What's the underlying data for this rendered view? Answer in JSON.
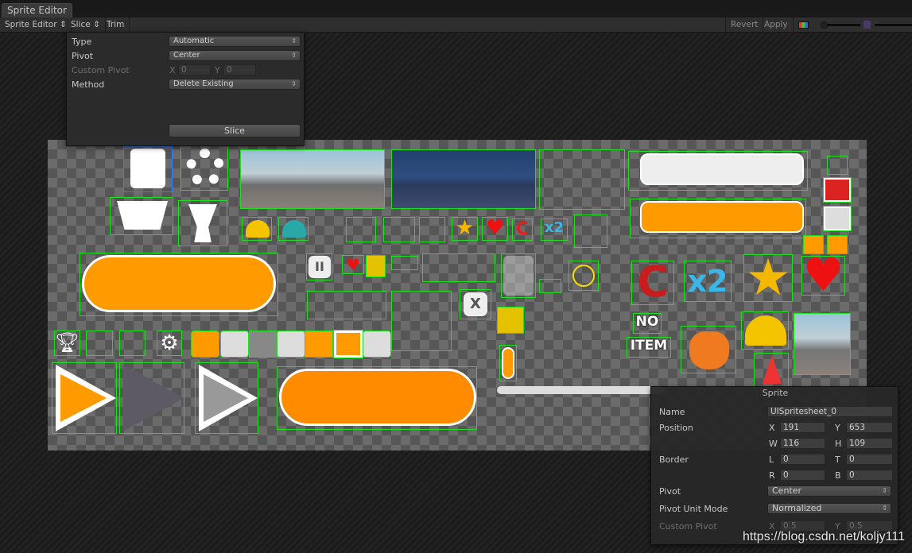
{
  "window": {
    "tab": "Sprite Editor"
  },
  "toolbar": {
    "mode": "Sprite Editor",
    "slice": "Slice",
    "trim": "Trim",
    "revert": "Revert",
    "apply": "Apply"
  },
  "slice_popup": {
    "type_label": "Type",
    "type_value": "Automatic",
    "pivot_label": "Pivot",
    "pivot_value": "Center",
    "custom_pivot_label": "Custom Pivot",
    "x_label": "X",
    "x_value": "0",
    "y_label": "Y",
    "y_value": "0",
    "method_label": "Method",
    "method_value": "Delete Existing",
    "slice_button": "Slice"
  },
  "sprite_panel": {
    "title": "Sprite",
    "name_label": "Name",
    "name_value": "UISpritesheet_0",
    "position_label": "Position",
    "x_label": "X",
    "x": "191",
    "y_label": "Y",
    "y": "653",
    "w_label": "W",
    "w": "116",
    "h_label": "H",
    "h": "109",
    "border_label": "Border",
    "l_label": "L",
    "l": "0",
    "t_label": "T",
    "t": "0",
    "r_label": "R",
    "r": "0",
    "b_label": "B",
    "b": "0",
    "pivot_label": "Pivot",
    "pivot_value": "Center",
    "pivot_unit_label": "Pivot Unit Mode",
    "pivot_unit_value": "Normalized",
    "custom_pivot_label": "Custom Pivot",
    "cx_label": "X",
    "cx": "0.5",
    "cy_label": "Y",
    "cy": "0.5"
  },
  "sheet_text": {
    "no": "NO",
    "item": "ITEM"
  },
  "watermark": "https://blog.csdn.net/koljy111",
  "colors": {
    "outline": "#1ee01e",
    "orange": "#ff9a00",
    "accent": "#3c3c3c"
  }
}
